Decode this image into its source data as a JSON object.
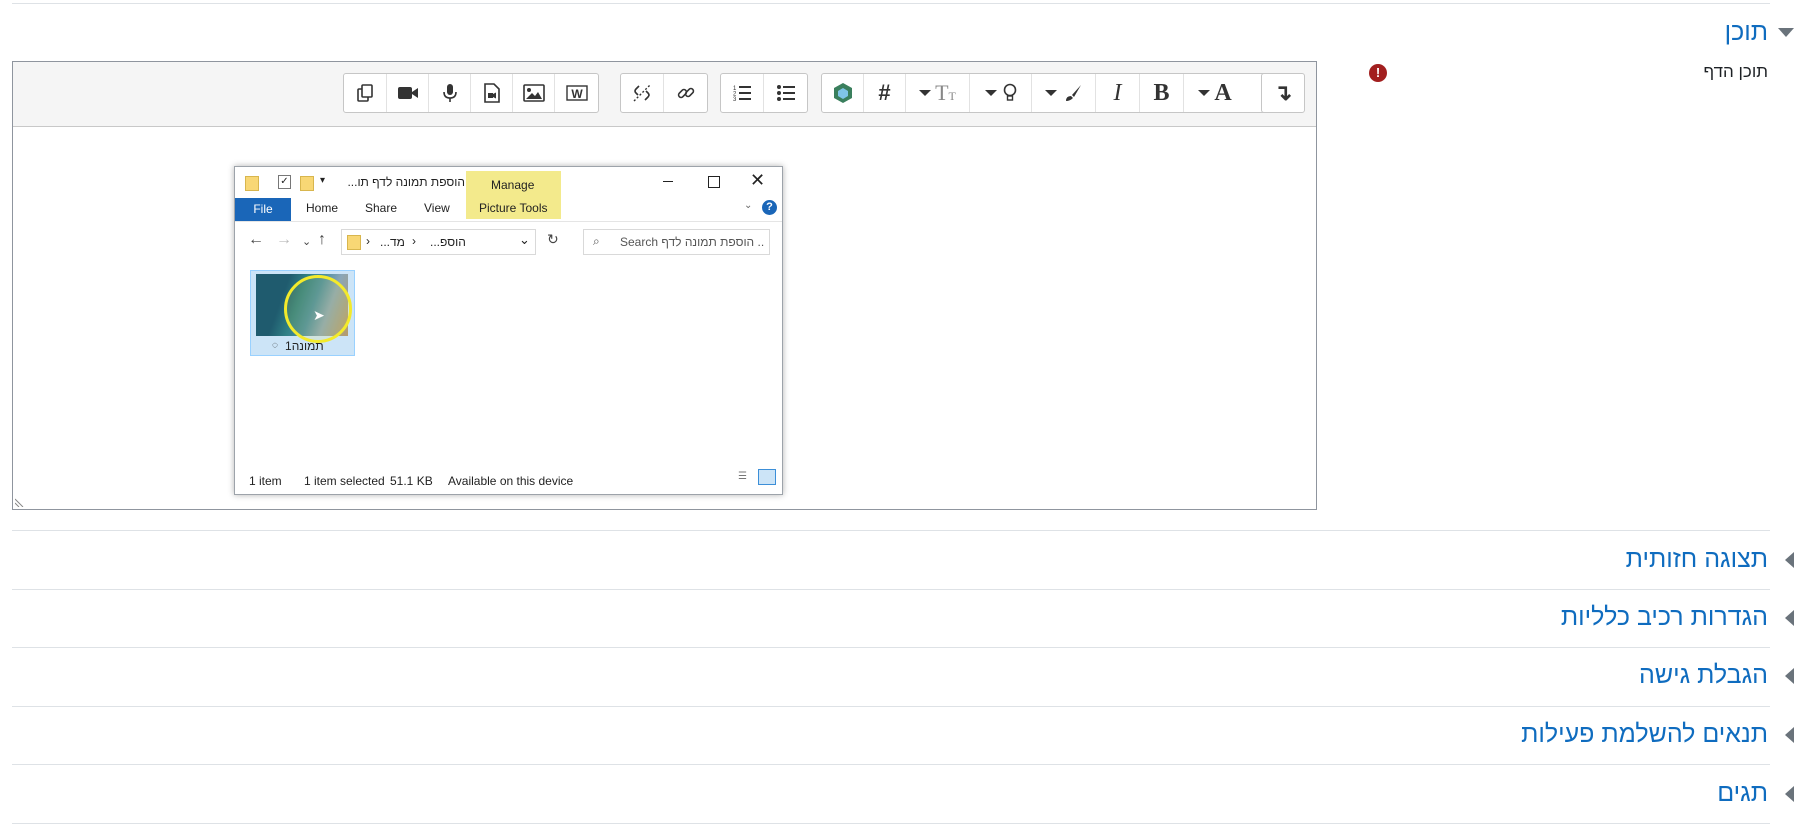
{
  "sections": {
    "content": {
      "title": "תוכן"
    },
    "appearance": {
      "title": "תצוגה חזותית"
    },
    "general": {
      "title": "הגדרות רכיב כלליות"
    },
    "restrict": {
      "title": "הגבלת גישה"
    },
    "completion": {
      "title": "תנאים להשלמת פעילות"
    },
    "tags": {
      "title": "תגים"
    }
  },
  "field": {
    "label": "תוכן הדף",
    "required_icon": "exclamation-icon"
  },
  "toolbar": {
    "buttons": [
      "expand",
      "font",
      "bold",
      "italic",
      "text-color",
      "highlight",
      "font-size",
      "equation",
      "wiris",
      "unordered-list",
      "ordered-list",
      "link",
      "unlink",
      "word",
      "image",
      "media",
      "record-audio",
      "record-video",
      "manage-files"
    ],
    "bold_label": "B",
    "italic_label": "I",
    "font_label": "A",
    "hash_label": "#"
  },
  "explorer": {
    "title": "הוספת תמונה לדף תו...",
    "manage_label": "Manage",
    "tabs": {
      "file": "File",
      "home": "Home",
      "share": "Share",
      "view": "View",
      "picture_tools": "Picture Tools"
    },
    "address": {
      "part1": "...הוספ",
      "part2": "...מד"
    },
    "search_placeholder": "Search הוספת תמונה לדף ...",
    "file": {
      "name": "תמונה1"
    },
    "status": {
      "items": "1 item",
      "selected": "1 item selected",
      "size": "51.1 KB",
      "availability": "Available on this device"
    }
  },
  "colors": {
    "link": "#0f6cbf",
    "required": "#a21f1f",
    "file_tab": "#1a66b8",
    "manage": "#f3ea8c"
  }
}
